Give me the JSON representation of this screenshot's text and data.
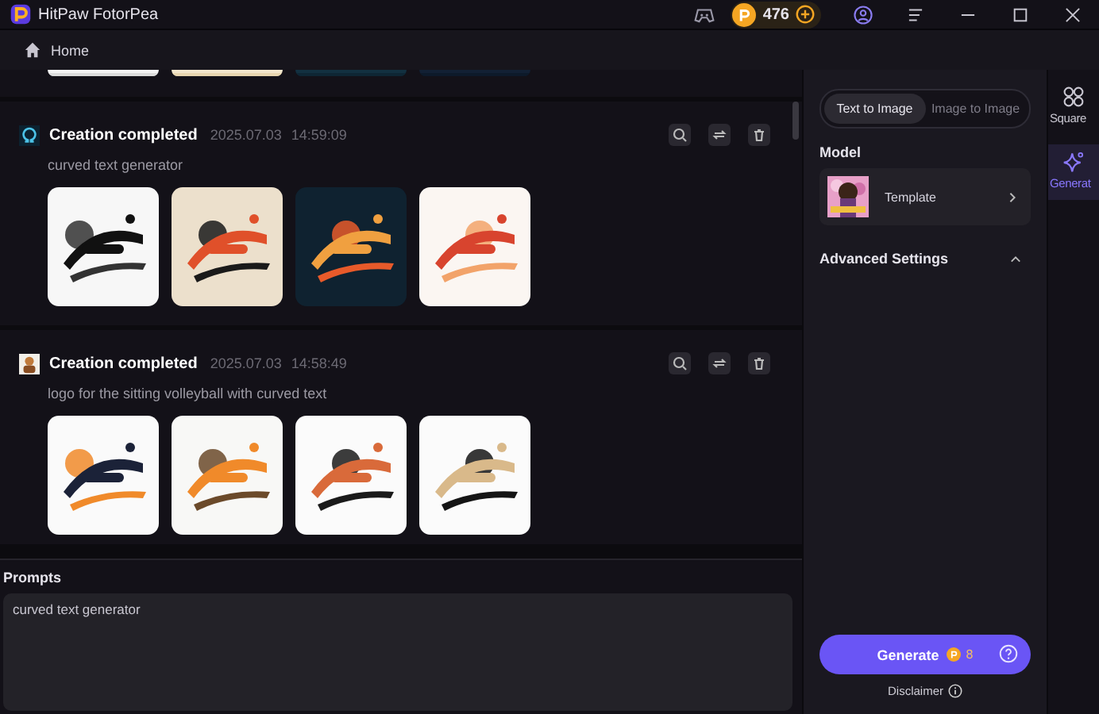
{
  "app": {
    "title": "HitPaw FotorPea",
    "coins": "476"
  },
  "nav": {
    "home": "Home"
  },
  "creations": [
    {
      "status": "Creation completed",
      "date": "2025.07.03",
      "time": "14:59:09",
      "prompt": "curved text generator"
    },
    {
      "status": "Creation completed",
      "date": "2025.07.03",
      "time": "14:58:49",
      "prompt": "logo for the sitting volleyball with curved text"
    }
  ],
  "prompts": {
    "label": "Prompts",
    "value": "curved text generator"
  },
  "modes": [
    {
      "label": "Text to Image",
      "selected": true
    },
    {
      "label": "Image to Image",
      "selected": false
    }
  ],
  "model": {
    "heading": "Model",
    "name": "Template"
  },
  "advanced": {
    "label": "Advanced Settings",
    "expanded": true
  },
  "generate": {
    "label": "Generate",
    "cost": "8"
  },
  "disclaimer": "Disclaimer",
  "rail": [
    {
      "label": "Square",
      "selected": false
    },
    {
      "label": "Generat",
      "selected": true
    }
  ]
}
